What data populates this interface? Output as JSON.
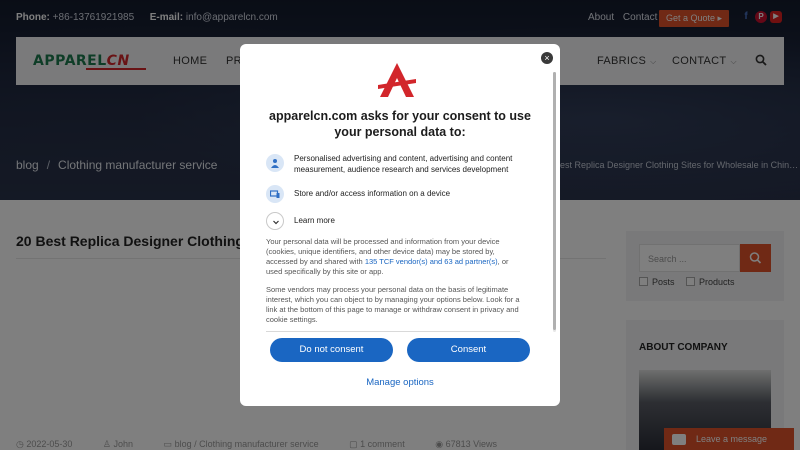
{
  "topbar": {
    "phone_label": "Phone:",
    "phone_value": "+86-13761921985",
    "email_label": "E-mail:",
    "email_value": "info@apparelcn.com",
    "links": [
      "About",
      "Contact"
    ],
    "quote_button": "Get a Quote ▸"
  },
  "nav": {
    "logo_main": "APPAREL",
    "logo_accent": "CN",
    "items": [
      {
        "label": "HOME"
      },
      {
        "label": "PR"
      },
      {
        "label": "FABRICS"
      },
      {
        "label": "CONTACT"
      }
    ],
    "chevron": "⌵"
  },
  "hero": {
    "breadcrumb": [
      "blog",
      "Clothing manufacturer service"
    ],
    "breadcrumb_separator": "/",
    "right_title": "est Replica Designer Clothing Sites for Wholesale in Chin…"
  },
  "article": {
    "title": "20 Best Replica Designer Clothing",
    "meta": {
      "date": "2022-05-30",
      "author": "John",
      "category": "blog / Clothing manufacturer service",
      "comments": "1 comment",
      "views": "67813 Views"
    }
  },
  "sidebar": {
    "search_placeholder": "Search ...",
    "filters": [
      "Posts",
      "Products"
    ],
    "about_heading": "ABOUT COMPANY"
  },
  "leave_message": "Leave a message",
  "consent": {
    "close": "×",
    "title": "apparelcn.com asks for your consent to use your personal data to:",
    "purposes": [
      "Personalised advertising and content, advertising and content measurement, audience research and services development",
      "Store and/or access information on a device"
    ],
    "learn_more": "Learn more",
    "para1_before": "Your personal data will be processed and information from your device (cookies, unique identifiers, and other device data) may be stored by, accessed by and shared with ",
    "para1_link": "135 TCF vendor(s) and 63 ad partner(s)",
    "para1_after": ", or used specifically by this site or app.",
    "para2": "Some vendors may process your personal data on the basis of legitimate interest, which you can object to by managing your options below. Look for a link at the bottom of this page to manage or withdraw consent in privacy and cookie settings.",
    "do_not_consent": "Do not consent",
    "consent": "Consent",
    "manage_options": "Manage options"
  },
  "colors": {
    "accent_orange": "#e0522b",
    "consent_blue": "#1a66c2",
    "logo_green": "#1d7a4e",
    "logo_red": "#d2262b"
  }
}
